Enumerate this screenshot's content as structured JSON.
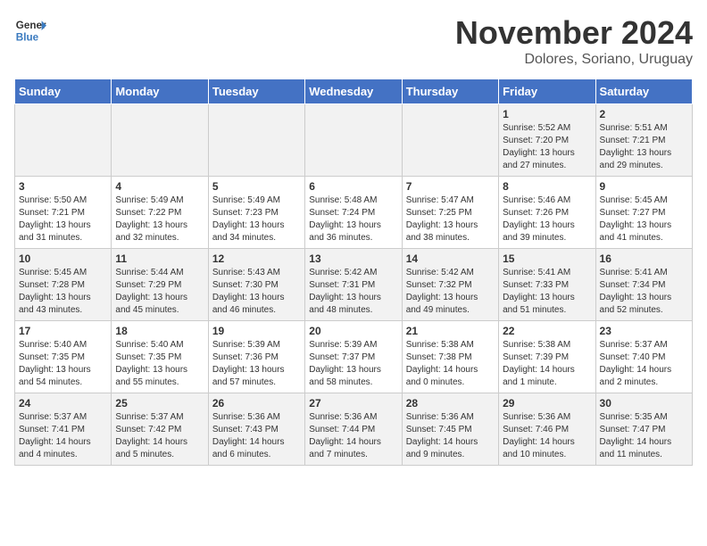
{
  "logo": {
    "line1": "General",
    "line2": "Blue"
  },
  "title": "November 2024",
  "location": "Dolores, Soriano, Uruguay",
  "days_header": [
    "Sunday",
    "Monday",
    "Tuesday",
    "Wednesday",
    "Thursday",
    "Friday",
    "Saturday"
  ],
  "weeks": [
    [
      {
        "num": "",
        "info": ""
      },
      {
        "num": "",
        "info": ""
      },
      {
        "num": "",
        "info": ""
      },
      {
        "num": "",
        "info": ""
      },
      {
        "num": "",
        "info": ""
      },
      {
        "num": "1",
        "info": "Sunrise: 5:52 AM\nSunset: 7:20 PM\nDaylight: 13 hours\nand 27 minutes."
      },
      {
        "num": "2",
        "info": "Sunrise: 5:51 AM\nSunset: 7:21 PM\nDaylight: 13 hours\nand 29 minutes."
      }
    ],
    [
      {
        "num": "3",
        "info": "Sunrise: 5:50 AM\nSunset: 7:21 PM\nDaylight: 13 hours\nand 31 minutes."
      },
      {
        "num": "4",
        "info": "Sunrise: 5:49 AM\nSunset: 7:22 PM\nDaylight: 13 hours\nand 32 minutes."
      },
      {
        "num": "5",
        "info": "Sunrise: 5:49 AM\nSunset: 7:23 PM\nDaylight: 13 hours\nand 34 minutes."
      },
      {
        "num": "6",
        "info": "Sunrise: 5:48 AM\nSunset: 7:24 PM\nDaylight: 13 hours\nand 36 minutes."
      },
      {
        "num": "7",
        "info": "Sunrise: 5:47 AM\nSunset: 7:25 PM\nDaylight: 13 hours\nand 38 minutes."
      },
      {
        "num": "8",
        "info": "Sunrise: 5:46 AM\nSunset: 7:26 PM\nDaylight: 13 hours\nand 39 minutes."
      },
      {
        "num": "9",
        "info": "Sunrise: 5:45 AM\nSunset: 7:27 PM\nDaylight: 13 hours\nand 41 minutes."
      }
    ],
    [
      {
        "num": "10",
        "info": "Sunrise: 5:45 AM\nSunset: 7:28 PM\nDaylight: 13 hours\nand 43 minutes."
      },
      {
        "num": "11",
        "info": "Sunrise: 5:44 AM\nSunset: 7:29 PM\nDaylight: 13 hours\nand 45 minutes."
      },
      {
        "num": "12",
        "info": "Sunrise: 5:43 AM\nSunset: 7:30 PM\nDaylight: 13 hours\nand 46 minutes."
      },
      {
        "num": "13",
        "info": "Sunrise: 5:42 AM\nSunset: 7:31 PM\nDaylight: 13 hours\nand 48 minutes."
      },
      {
        "num": "14",
        "info": "Sunrise: 5:42 AM\nSunset: 7:32 PM\nDaylight: 13 hours\nand 49 minutes."
      },
      {
        "num": "15",
        "info": "Sunrise: 5:41 AM\nSunset: 7:33 PM\nDaylight: 13 hours\nand 51 minutes."
      },
      {
        "num": "16",
        "info": "Sunrise: 5:41 AM\nSunset: 7:34 PM\nDaylight: 13 hours\nand 52 minutes."
      }
    ],
    [
      {
        "num": "17",
        "info": "Sunrise: 5:40 AM\nSunset: 7:35 PM\nDaylight: 13 hours\nand 54 minutes."
      },
      {
        "num": "18",
        "info": "Sunrise: 5:40 AM\nSunset: 7:35 PM\nDaylight: 13 hours\nand 55 minutes."
      },
      {
        "num": "19",
        "info": "Sunrise: 5:39 AM\nSunset: 7:36 PM\nDaylight: 13 hours\nand 57 minutes."
      },
      {
        "num": "20",
        "info": "Sunrise: 5:39 AM\nSunset: 7:37 PM\nDaylight: 13 hours\nand 58 minutes."
      },
      {
        "num": "21",
        "info": "Sunrise: 5:38 AM\nSunset: 7:38 PM\nDaylight: 14 hours\nand 0 minutes."
      },
      {
        "num": "22",
        "info": "Sunrise: 5:38 AM\nSunset: 7:39 PM\nDaylight: 14 hours\nand 1 minute."
      },
      {
        "num": "23",
        "info": "Sunrise: 5:37 AM\nSunset: 7:40 PM\nDaylight: 14 hours\nand 2 minutes."
      }
    ],
    [
      {
        "num": "24",
        "info": "Sunrise: 5:37 AM\nSunset: 7:41 PM\nDaylight: 14 hours\nand 4 minutes."
      },
      {
        "num": "25",
        "info": "Sunrise: 5:37 AM\nSunset: 7:42 PM\nDaylight: 14 hours\nand 5 minutes."
      },
      {
        "num": "26",
        "info": "Sunrise: 5:36 AM\nSunset: 7:43 PM\nDaylight: 14 hours\nand 6 minutes."
      },
      {
        "num": "27",
        "info": "Sunrise: 5:36 AM\nSunset: 7:44 PM\nDaylight: 14 hours\nand 7 minutes."
      },
      {
        "num": "28",
        "info": "Sunrise: 5:36 AM\nSunset: 7:45 PM\nDaylight: 14 hours\nand 9 minutes."
      },
      {
        "num": "29",
        "info": "Sunrise: 5:36 AM\nSunset: 7:46 PM\nDaylight: 14 hours\nand 10 minutes."
      },
      {
        "num": "30",
        "info": "Sunrise: 5:35 AM\nSunset: 7:47 PM\nDaylight: 14 hours\nand 11 minutes."
      }
    ]
  ]
}
